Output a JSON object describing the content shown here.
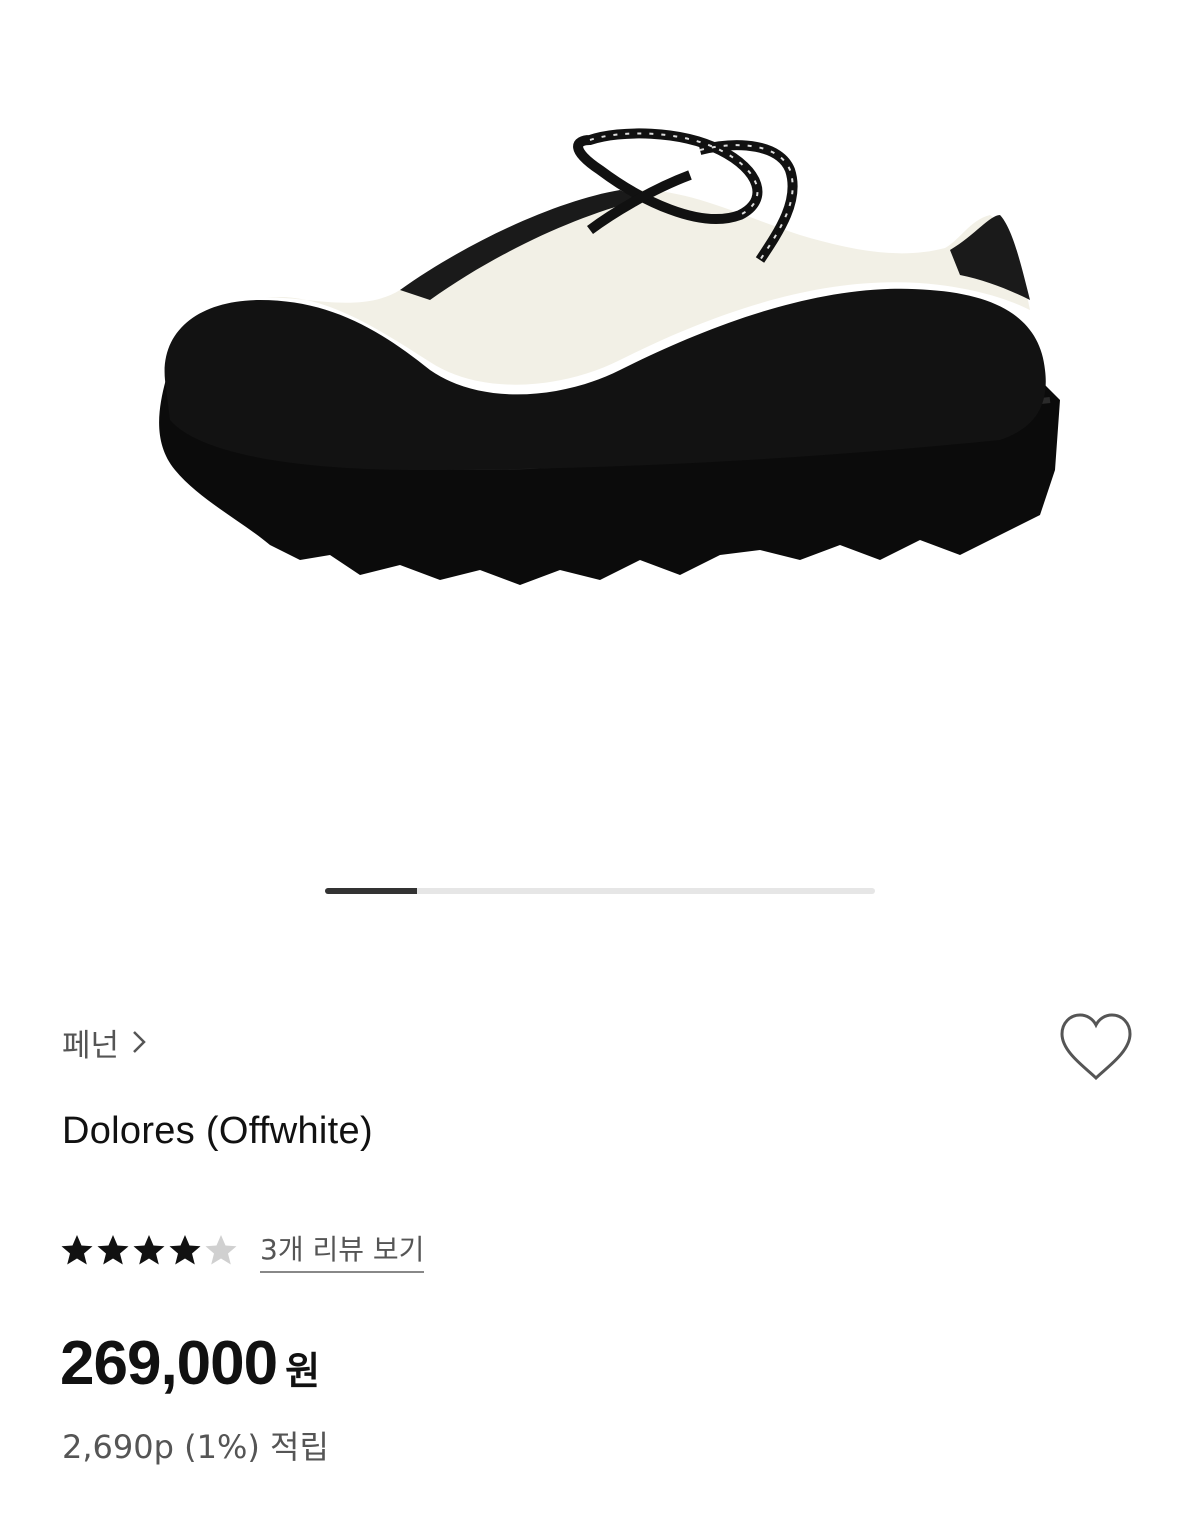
{
  "gallery": {
    "image_alt": "Dolores (Offwhite) shoe side view",
    "current_index": 1,
    "total_images": 6,
    "progress_fraction": 0.167
  },
  "brand": {
    "name": "페넌"
  },
  "product": {
    "title": "Dolores (Offwhite)",
    "rating": 4,
    "rating_max": 5,
    "review_link": "3개 리뷰 보기",
    "price": "269,000",
    "currency": "원",
    "points": "2,690p (1%) 적립"
  },
  "icons": {
    "wishlist": "heart-outline-icon",
    "brand_chevron": "chevron-right-icon",
    "star_filled": "star-filled-icon",
    "star_empty": "star-empty-icon"
  },
  "colors": {
    "text": "#111111",
    "muted": "#555555",
    "star_empty": "#d0d0d0"
  }
}
